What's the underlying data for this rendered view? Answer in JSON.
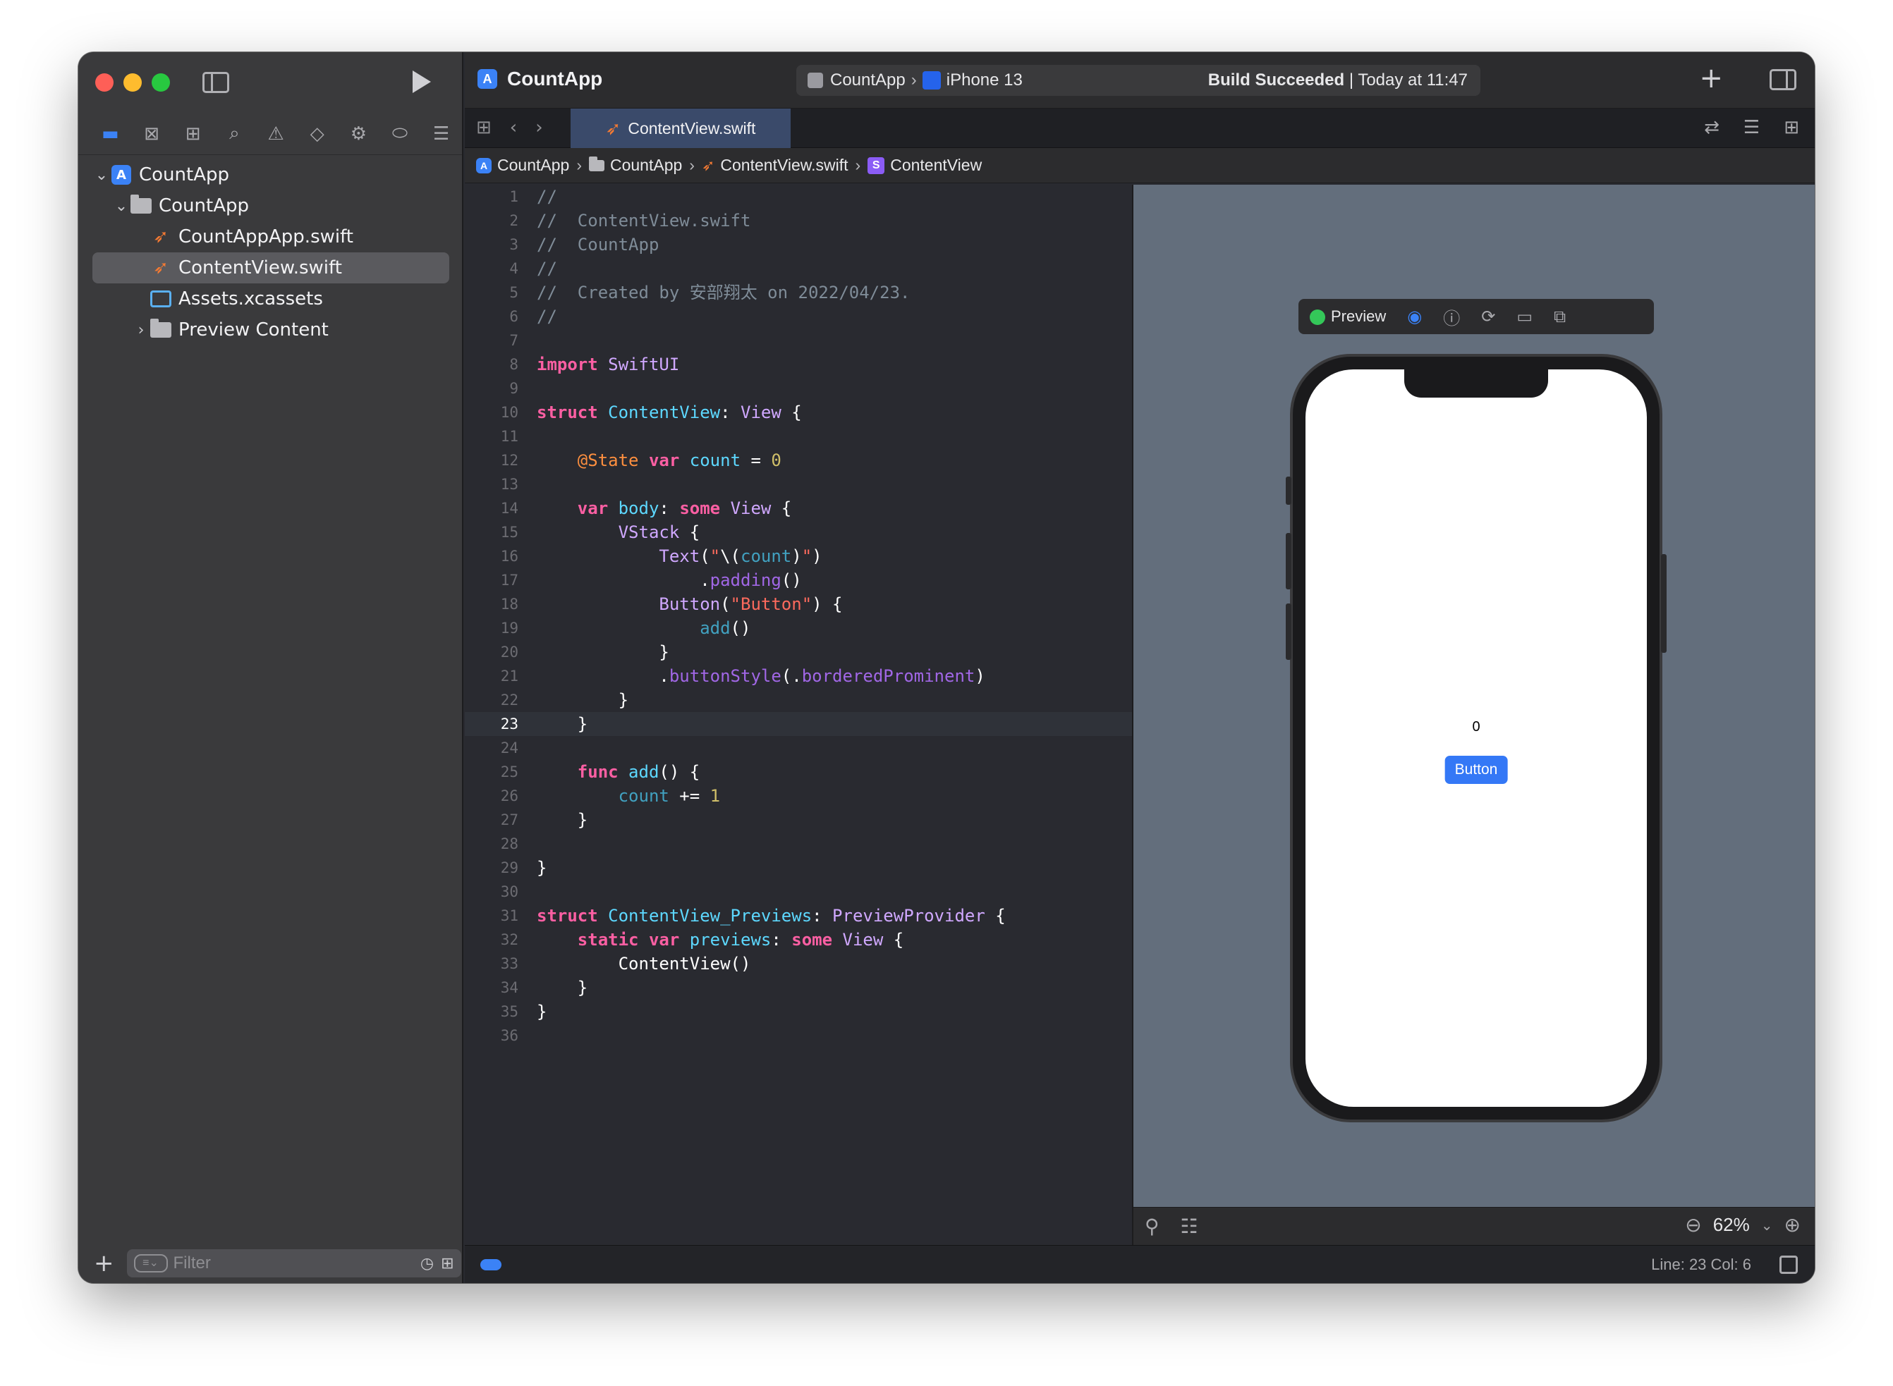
{
  "window": {
    "project": "CountApp"
  },
  "navigator": {
    "tabs": [
      "folder-icon",
      "source-control-icon",
      "symbols-icon",
      "search-icon",
      "warning-icon",
      "test-icon",
      "debug-icon",
      "breakpoint-icon",
      "report-icon"
    ],
    "tree": [
      {
        "label": "CountApp",
        "icon": "app-icon",
        "level": 0,
        "expanded": true
      },
      {
        "label": "CountApp",
        "icon": "folder-icon",
        "level": 1,
        "expanded": true
      },
      {
        "label": "CountAppApp.swift",
        "icon": "swift-icon",
        "level": 2
      },
      {
        "label": "ContentView.swift",
        "icon": "swift-icon",
        "level": 2,
        "selected": true
      },
      {
        "label": "Assets.xcassets",
        "icon": "assets-icon",
        "level": 2
      },
      {
        "label": "Preview Content",
        "icon": "folder-icon",
        "level": 2,
        "expanded": false
      }
    ],
    "filter_placeholder": "Filter"
  },
  "toolbar": {
    "project_title": "CountApp",
    "scheme": "CountApp",
    "device": "iPhone 13",
    "build_status_bold": "Build Succeeded",
    "build_status_time": " | Today at 11:47"
  },
  "tabbar": {
    "active_tab": "ContentView.swift"
  },
  "jumpbar": {
    "items": [
      "CountApp",
      "CountApp",
      "ContentView.swift",
      "ContentView"
    ]
  },
  "editor": {
    "current_line": 23,
    "lines": [
      "//",
      "//  ContentView.swift",
      "//  CountApp",
      "//",
      "//  Created by 安部翔太 on 2022/04/23.",
      "//",
      "",
      "import SwiftUI",
      "",
      "struct ContentView: View {",
      "",
      "    @State var count = 0",
      "",
      "    var body: some View {",
      "        VStack {",
      "            Text(\"\\(count)\")",
      "                .padding()",
      "            Button(\"Button\") {",
      "                add()",
      "            }",
      "            .buttonStyle(.borderedProminent)",
      "        }",
      "    }",
      "",
      "    func add() {",
      "        count += 1",
      "    }",
      "",
      "}",
      "",
      "struct ContentView_Previews: PreviewProvider {",
      "    static var previews: some View {",
      "        ContentView()",
      "    }",
      "}",
      ""
    ]
  },
  "preview": {
    "label": "Preview",
    "counter_text": "0",
    "button_label": "Button",
    "zoom": "62%"
  },
  "status": {
    "cursor": "Line: 23  Col: 6"
  },
  "colors": {
    "accent": "#3b82f6",
    "preview_bg": "#636e7c",
    "editor_bg": "#292a30",
    "live_dot": "#34c759"
  }
}
